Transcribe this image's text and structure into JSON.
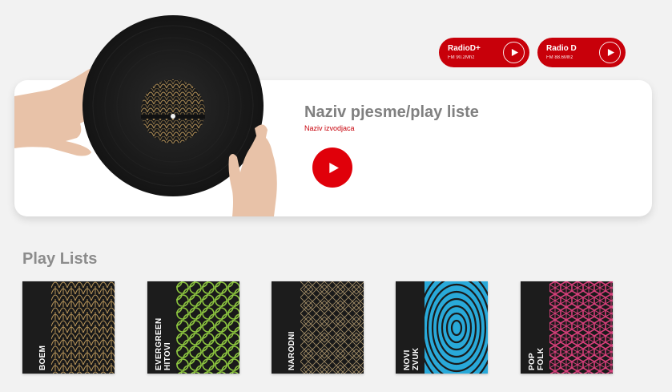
{
  "radios": [
    {
      "name": "RadioD+",
      "freq": "FM 90.2Mhz"
    },
    {
      "name": "Radio D",
      "freq": "FM 88.6Mhz"
    }
  ],
  "player": {
    "title": "Naziv pjesme/play liste",
    "artist": "Naziv izvodjaca"
  },
  "section": {
    "title": "Play Lists"
  },
  "playlists": [
    {
      "label": "BOEM",
      "color": "#b8955a"
    },
    {
      "label": "EVERGREEN\nHITOVI",
      "color": "#8dc63f"
    },
    {
      "label": "NARODNI",
      "color": "#a8926a"
    },
    {
      "label": "NOVI\nZVUK",
      "color": "#29a9d9"
    },
    {
      "label": "POP\nFOLK",
      "color": "#d63f7a"
    }
  ],
  "colors": {
    "accent": "#c8000a",
    "play": "#e0000a"
  }
}
